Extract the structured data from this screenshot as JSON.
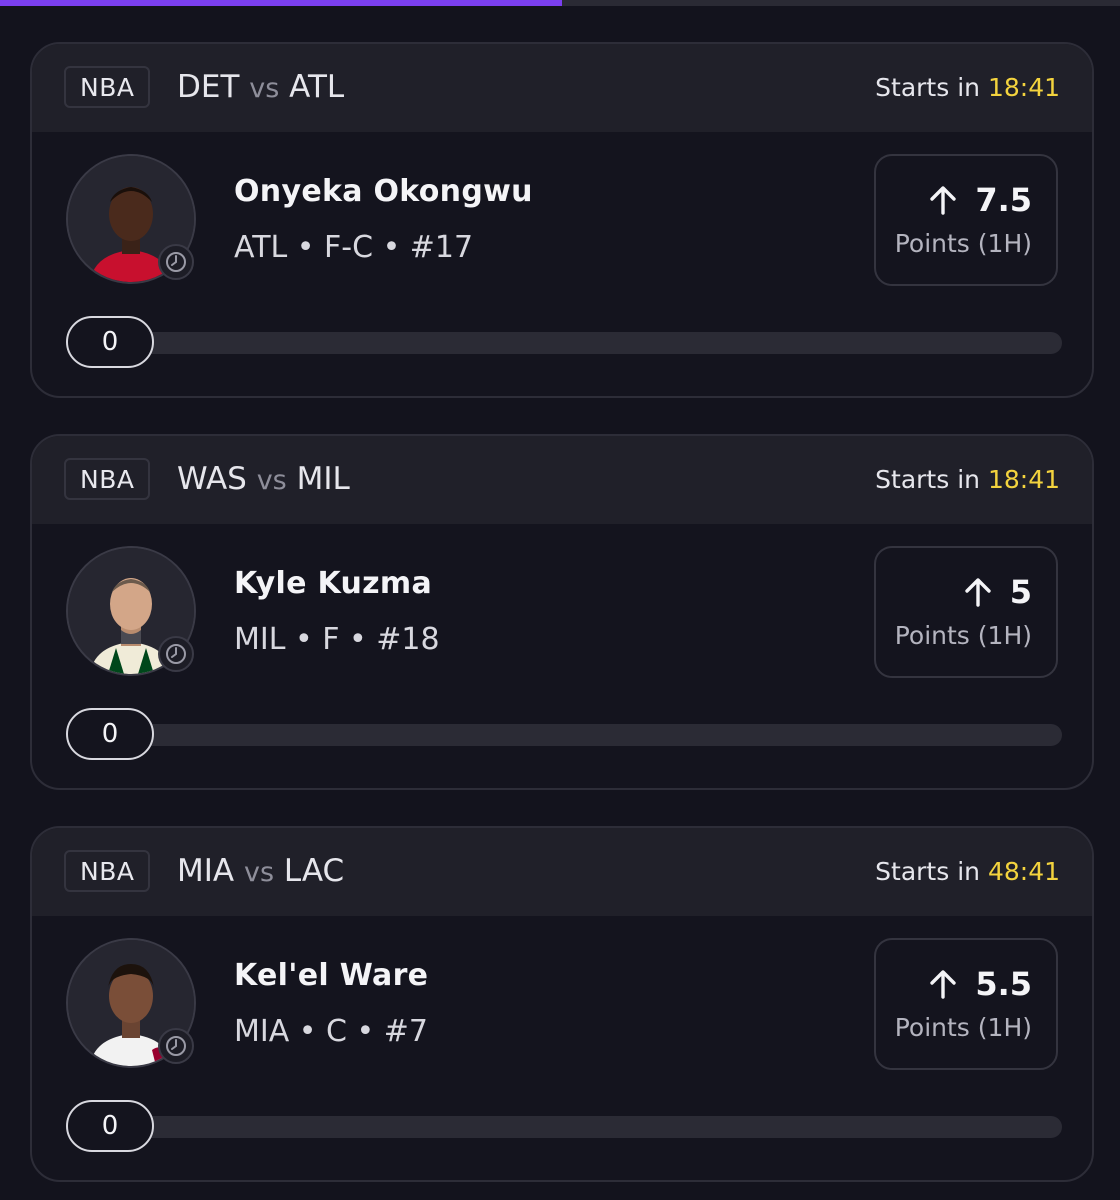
{
  "cards": [
    {
      "league": "NBA",
      "team_a": "DET",
      "vs": "vs",
      "team_b": "ATL",
      "starts_label": "Starts in",
      "starts_time": "18:41",
      "player_name": "Onyeka Okongwu",
      "player_meta": "ATL • F-C • #17",
      "line_value": "7.5",
      "line_direction_icon": "arrow-up-icon",
      "stat": "Points (1H)",
      "current_value": "0",
      "progress": 0,
      "jersey_color": "#c8102e"
    },
    {
      "league": "NBA",
      "team_a": "WAS",
      "vs": "vs",
      "team_b": "MIL",
      "starts_label": "Starts in",
      "starts_time": "18:41",
      "player_name": "Kyle Kuzma",
      "player_meta": "MIL • F • #18",
      "line_value": "5",
      "line_direction_icon": "arrow-up-icon",
      "stat": "Points (1H)",
      "current_value": "0",
      "progress": 0,
      "jersey_color": "#f0ebd8"
    },
    {
      "league": "NBA",
      "team_a": "MIA",
      "vs": "vs",
      "team_b": "LAC",
      "starts_label": "Starts in",
      "starts_time": "48:41",
      "player_name": "Kel'el Ware",
      "player_meta": "MIA • C • #7",
      "line_value": "5.5",
      "line_direction_icon": "arrow-up-icon",
      "stat": "Points (1H)",
      "current_value": "0",
      "progress": 0,
      "jersey_color": "#f2f2f2"
    }
  ],
  "colors": {
    "accent": "#7b3ff0",
    "time": "#f3d33e",
    "background": "#13131d",
    "header": "#202029"
  }
}
